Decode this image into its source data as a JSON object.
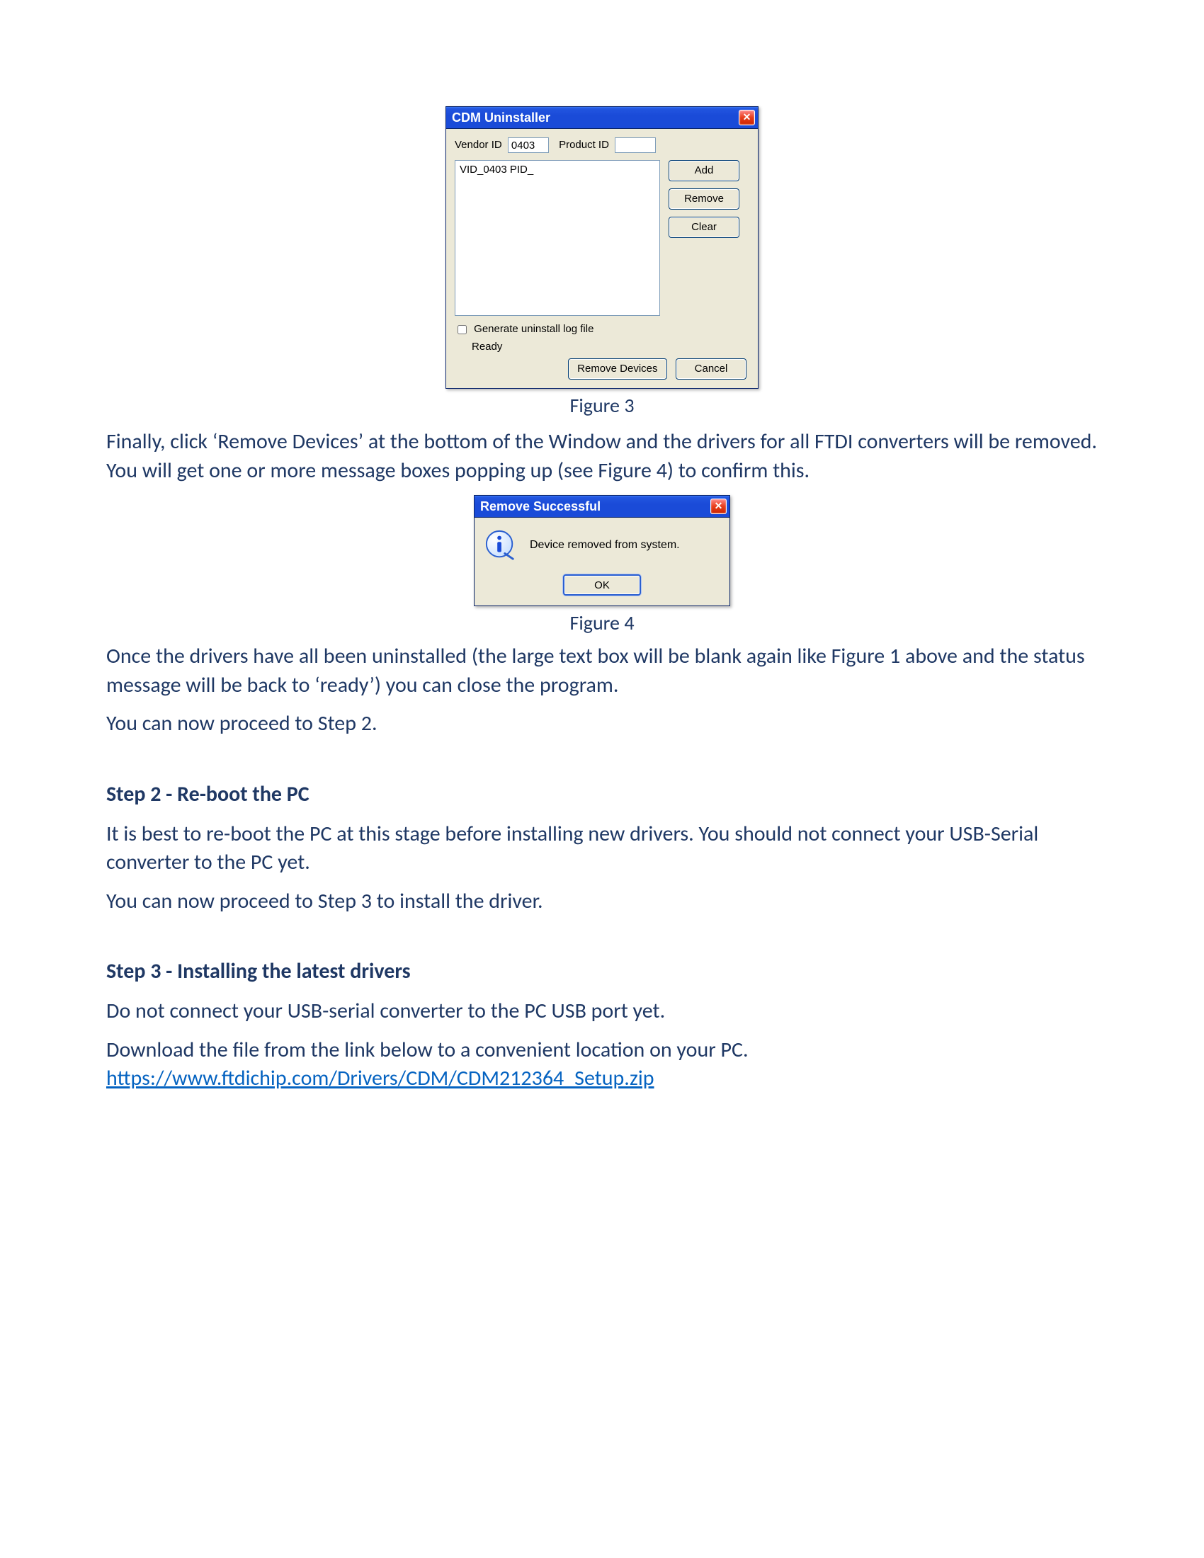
{
  "dialog1": {
    "title": "CDM Uninstaller",
    "vendor_id_label": "Vendor ID",
    "vendor_id_value": "0403",
    "product_id_label": "Product ID",
    "product_id_value": "",
    "listbox_entry": "VID_0403 PID_",
    "btn_add": "Add",
    "btn_remove": "Remove",
    "btn_clear": "Clear",
    "checkbox_label": "Generate uninstall log file",
    "status_text": "Ready",
    "btn_remove_devices": "Remove Devices",
    "btn_cancel": "Cancel"
  },
  "caption1": "Figure 3",
  "para1": "Finally, click ‘Remove Devices’ at the bottom of the Window and the drivers for all FTDI converters will be removed. You will get one or more message boxes popping up (see Figure 4) to confirm this.",
  "dialog2": {
    "title": "Remove Successful",
    "message": "Device removed from system.",
    "btn_ok": "OK"
  },
  "caption2": "Figure 4",
  "para2": "Once the drivers have all been uninstalled (the large text box will be blank again like Figure 1 above and the status message will be back to ‘ready’) you can close the program.",
  "para3": "You can now proceed to Step 2.",
  "heading_step2": "Step 2 - Re-boot the PC",
  "para4": "It is best to re-boot the PC at this stage before installing new drivers. You should not connect your USB-Serial converter to the PC yet.",
  "para5": "You can now proceed to Step 3 to install the driver.",
  "heading_step3": "Step 3 - Installing the latest drivers",
  "para6": "Do not connect your USB-serial converter to the PC USB port yet.",
  "para7": "Download the file from the link below to a convenient location on your PC.",
  "link_text": "https://www.ftdichip.com/Drivers/CDM/CDM212364_Setup.zip"
}
